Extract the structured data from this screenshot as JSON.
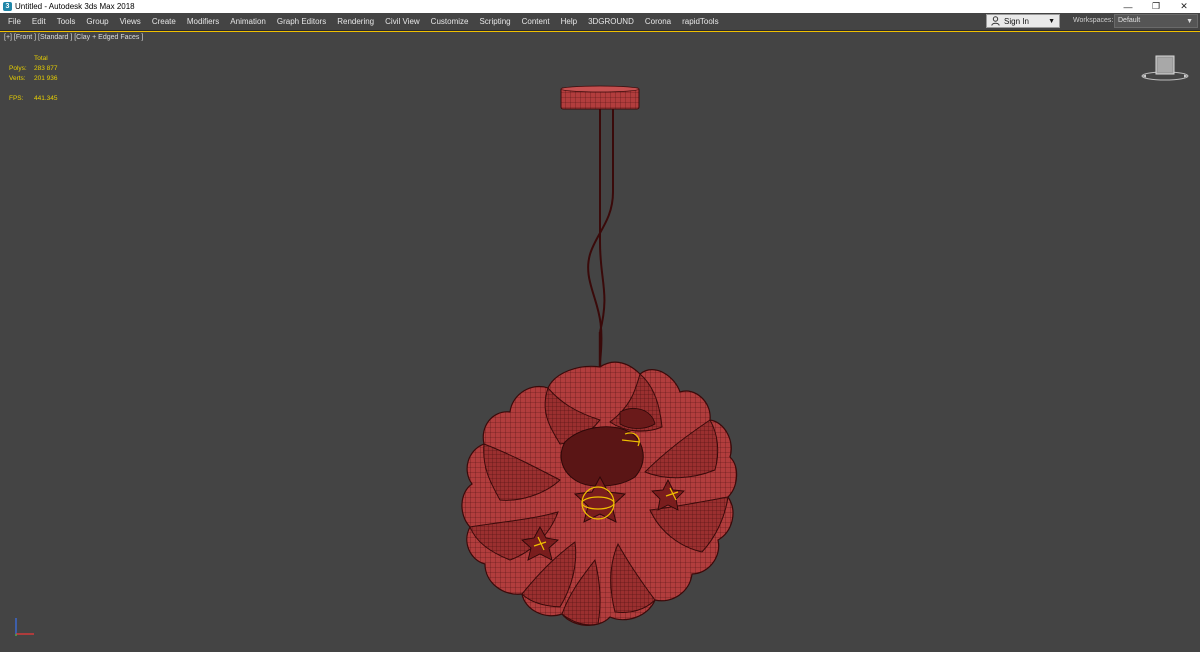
{
  "window": {
    "title": "Untitled - Autodesk 3ds Max 2018",
    "app_icon_glyph": "3",
    "controls": {
      "minimize": "—",
      "restore": "❐",
      "close": "✕"
    }
  },
  "menu": [
    "File",
    "Edit",
    "Tools",
    "Group",
    "Views",
    "Create",
    "Modifiers",
    "Animation",
    "Graph Editors",
    "Rendering",
    "Civil View",
    "Customize",
    "Scripting",
    "Content",
    "Help",
    "3DGROUND",
    "Corona",
    "rapidTools"
  ],
  "account": {
    "sign_in_label": "Sign In"
  },
  "workspaces": {
    "label": "Workspaces:",
    "selected": "Default"
  },
  "viewport": {
    "label": "[+] [Front ] [Standard ] [Clay + Edged Faces ]",
    "stats": {
      "total_label": "Total",
      "polys_label": "Polys:",
      "polys_value": "283 877",
      "verts_label": "Verts:",
      "verts_value": "201 936",
      "fps_label": "FPS:",
      "fps_value": "441.345"
    },
    "viewcube_icon": "viewcube-icon",
    "model_color": "#b03c3c",
    "wire_color": "#4a0d0d",
    "selection_color": "#f0c000"
  }
}
